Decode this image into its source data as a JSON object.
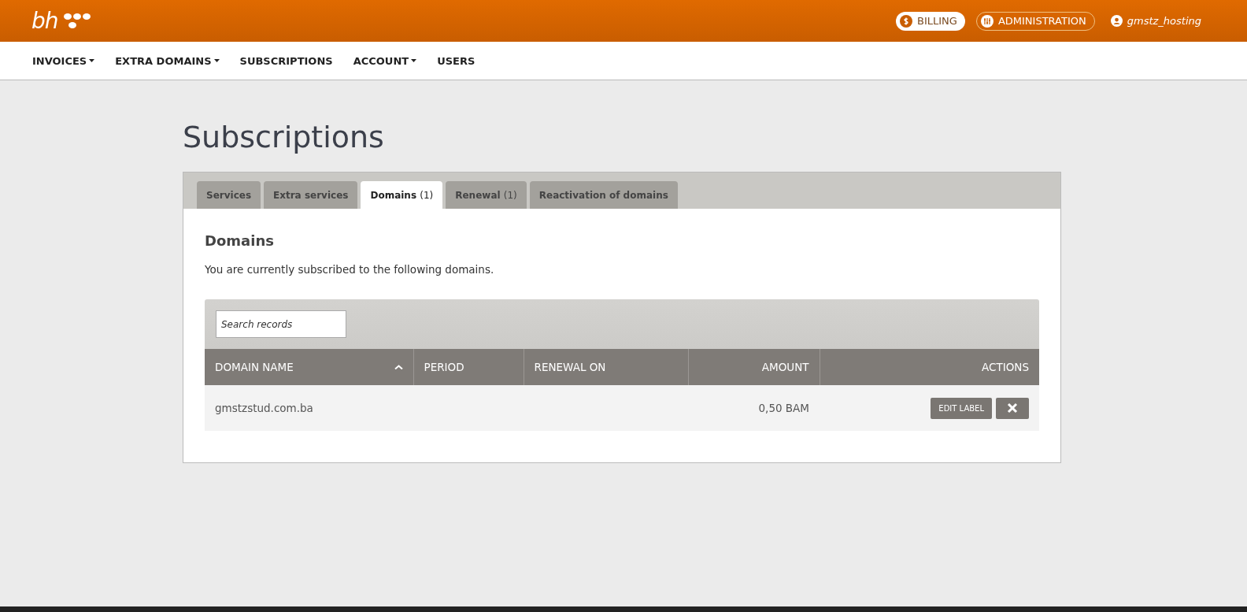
{
  "header": {
    "logo": "bh",
    "billing": "BILLING",
    "administration": "ADMINISTRATION",
    "user": "gmstz_hosting"
  },
  "nav": [
    {
      "label": "INVOICES",
      "dropdown": true
    },
    {
      "label": "EXTRA DOMAINS",
      "dropdown": true
    },
    {
      "label": "SUBSCRIPTIONS",
      "dropdown": false
    },
    {
      "label": "ACCOUNT",
      "dropdown": true
    },
    {
      "label": "USERS",
      "dropdown": false
    }
  ],
  "page_title": "Subscriptions",
  "tabs": [
    {
      "label": "Services",
      "selected": false
    },
    {
      "label": "Extra services",
      "selected": false
    },
    {
      "label": "Domains",
      "count": "(1)",
      "selected": true
    },
    {
      "label": "Renewal",
      "count": "(1)",
      "selected": false
    },
    {
      "label": "Reactivation of domains",
      "selected": false
    }
  ],
  "section": {
    "title": "Domains",
    "description": "You are currently subscribed to the following domains."
  },
  "search": {
    "placeholder": "Search records"
  },
  "table": {
    "columns": [
      {
        "label": "DOMAIN NAME",
        "kind": "text",
        "sorted": true
      },
      {
        "label": "PERIOD",
        "kind": "text",
        "sorted": false
      },
      {
        "label": "RENEWAL ON",
        "kind": "text",
        "sorted": false
      },
      {
        "label": "AMOUNT",
        "kind": "number",
        "sorted": false
      },
      {
        "label": "ACTIONS",
        "kind": "actions",
        "sorted": false
      }
    ],
    "rows": [
      {
        "domain_name": "gmstzstud.com.ba",
        "amount": "0,50  BAM",
        "edit_button": "EDIT LABEL"
      }
    ]
  }
}
